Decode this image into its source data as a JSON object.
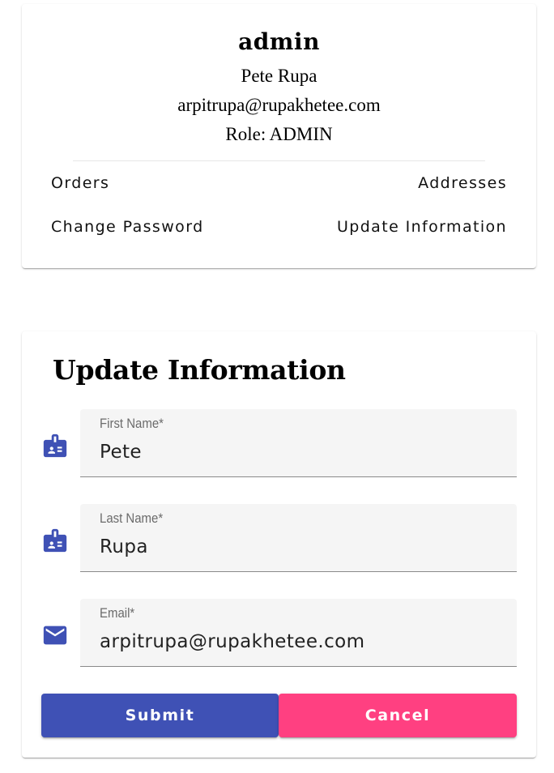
{
  "profile": {
    "username": "admin",
    "full_name": "Pete Rupa",
    "email": "arpitrupa@rupakhetee.com",
    "role_text": "Role: ADMIN",
    "links": {
      "orders": "Orders",
      "addresses": "Addresses",
      "change_password": "Change Password",
      "update_information": "Update Information"
    }
  },
  "update_form": {
    "title": "Update Information",
    "first_name": {
      "label": "First Name*",
      "value": "Pete",
      "icon": "badge-icon"
    },
    "last_name": {
      "label": "Last Name*",
      "value": "Rupa",
      "icon": "badge-icon"
    },
    "email": {
      "label": "Email*",
      "value": "arpitrupa@rupakhetee.com",
      "icon": "mail-icon"
    },
    "submit_label": "Submit",
    "cancel_label": "Cancel"
  },
  "colors": {
    "primary": "#3f51b5",
    "accent": "#ff4081",
    "icon": "#3f51b5"
  }
}
